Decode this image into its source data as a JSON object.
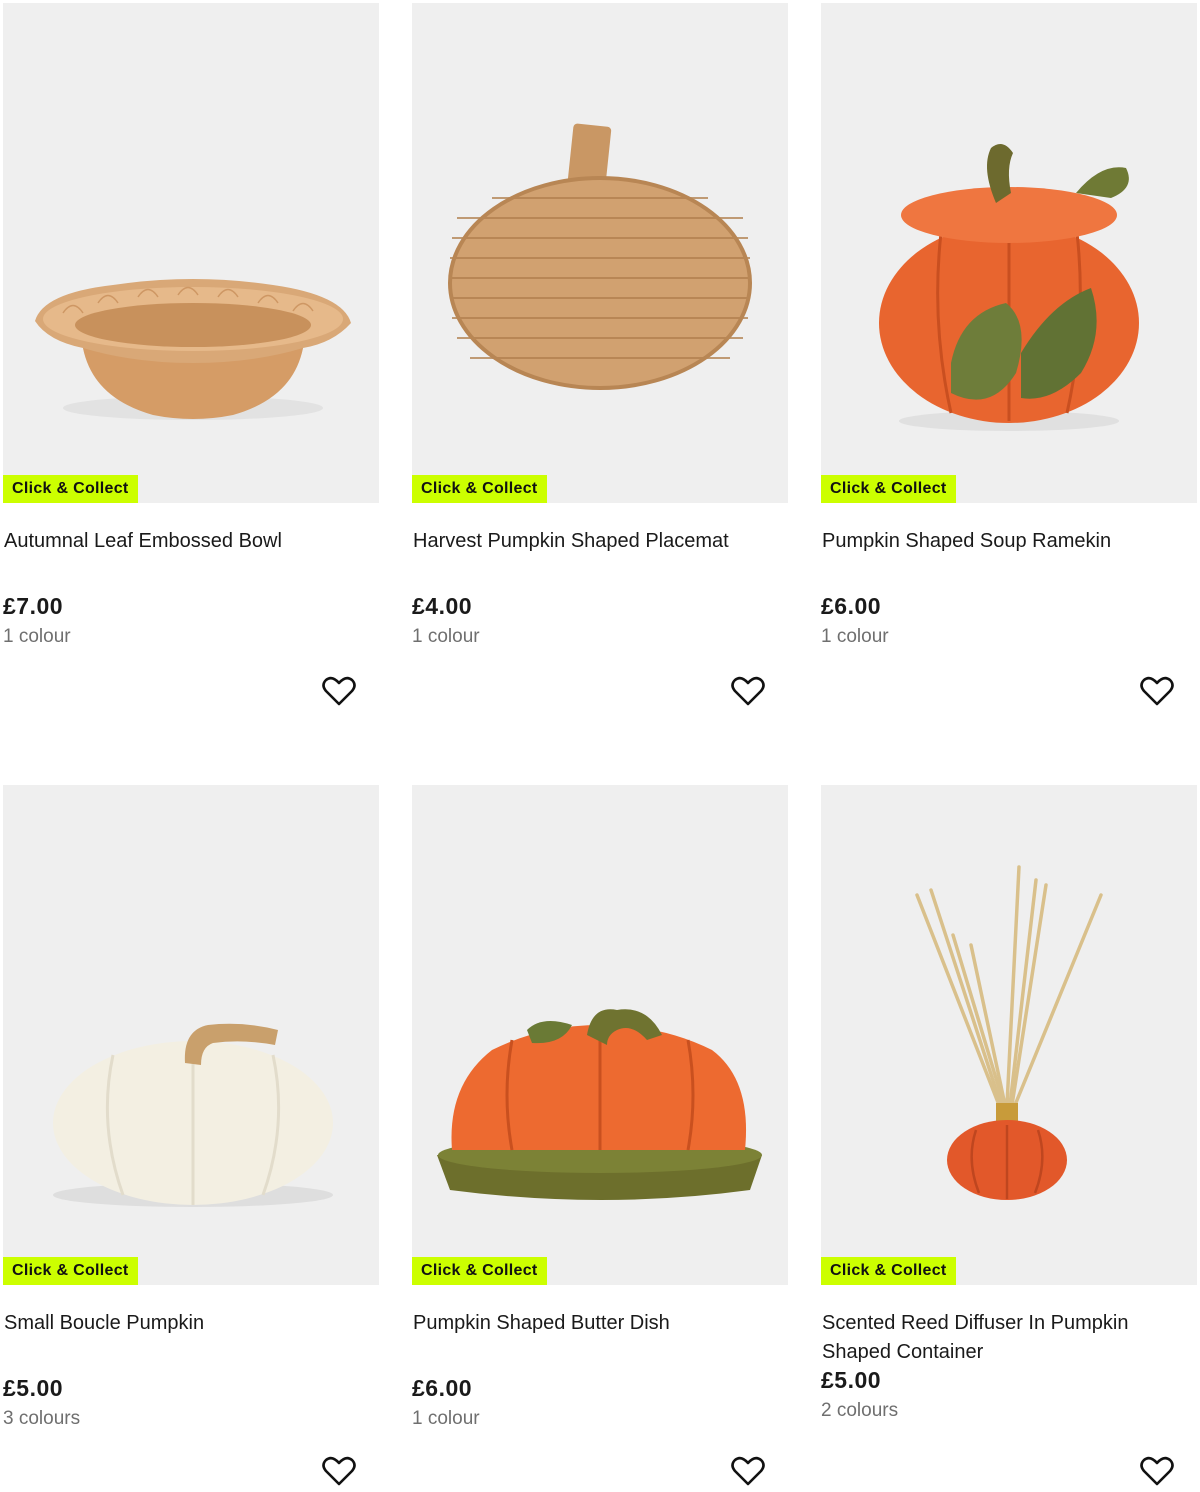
{
  "products": [
    {
      "title": "Autumnal Leaf Embossed Bowl",
      "price": "£7.00",
      "colours": "1 colour",
      "badge": "Click & Collect"
    },
    {
      "title": "Harvest Pumpkin Shaped Placemat",
      "price": "£4.00",
      "colours": "1 colour",
      "badge": "Click & Collect"
    },
    {
      "title": "Pumpkin Shaped Soup Ramekin",
      "price": "£6.00",
      "colours": "1 colour",
      "badge": "Click & Collect"
    },
    {
      "title": "Small Boucle Pumpkin",
      "price": "£5.00",
      "colours": "3 colours",
      "badge": "Click & Collect"
    },
    {
      "title": "Pumpkin Shaped Butter Dish",
      "price": "£6.00",
      "colours": "1 colour",
      "badge": "Click & Collect"
    },
    {
      "title": "Scented Reed Diffuser In Pumpkin Shaped Container",
      "price": "£5.00",
      "colours": "2 colours",
      "badge": "Click & Collect"
    }
  ],
  "icons": {
    "wishlist": "heart-outline-icon"
  },
  "colors": {
    "badge_bg": "#ccff00",
    "image_bg": "#efefef",
    "muted_text": "#6f6f6f"
  }
}
